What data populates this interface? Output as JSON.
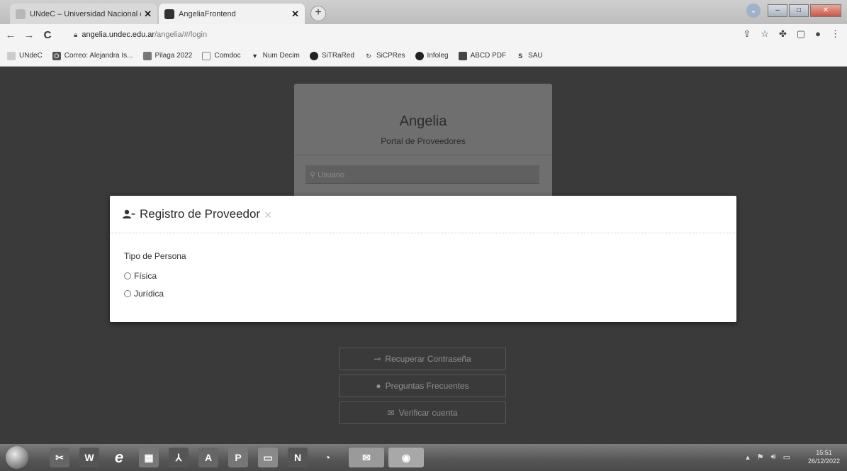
{
  "browser": {
    "tabs": [
      {
        "title": "UNdeC – Universidad Nacional c",
        "active": false
      },
      {
        "title": "AngeliaFrontend",
        "active": true
      }
    ],
    "new_tab_label": "+",
    "url_host": "angelia.undec.edu.ar",
    "url_path": "/angelia/#/login",
    "bookmarks": [
      {
        "label": "UNdeC",
        "icon": "undec-icon"
      },
      {
        "label": "Correo: Alejandra Is...",
        "icon": "outlook-icon"
      },
      {
        "label": "Pilaga 2022",
        "icon": "pilaga-icon"
      },
      {
        "label": "Comdoc",
        "icon": "comdoc-icon"
      },
      {
        "label": "Num Decim",
        "icon": "numdecim-icon"
      },
      {
        "label": "SiTRaRed",
        "icon": "sitrared-icon"
      },
      {
        "label": "SiCPRes",
        "icon": "sicpres-icon"
      },
      {
        "label": "Infoleg",
        "icon": "infoleg-icon"
      },
      {
        "label": "ABCD PDF",
        "icon": "pdf-icon"
      },
      {
        "label": "SAU",
        "icon": "sau-icon"
      }
    ]
  },
  "login": {
    "title": "Angelia",
    "subtitle": "Portal de Proveedores",
    "username_placeholder": "Usuario",
    "recover_password": "Recuperar Contraseña",
    "faq": "Preguntas Frecuentes",
    "verify_account": "Verificar cuenta"
  },
  "modal": {
    "title": "Registro de Proveedor",
    "field_label": "Tipo de Persona",
    "options": [
      "Física",
      "Jurídica"
    ]
  },
  "taskbar": {
    "time": "15:51",
    "date": "26/12/2022"
  }
}
